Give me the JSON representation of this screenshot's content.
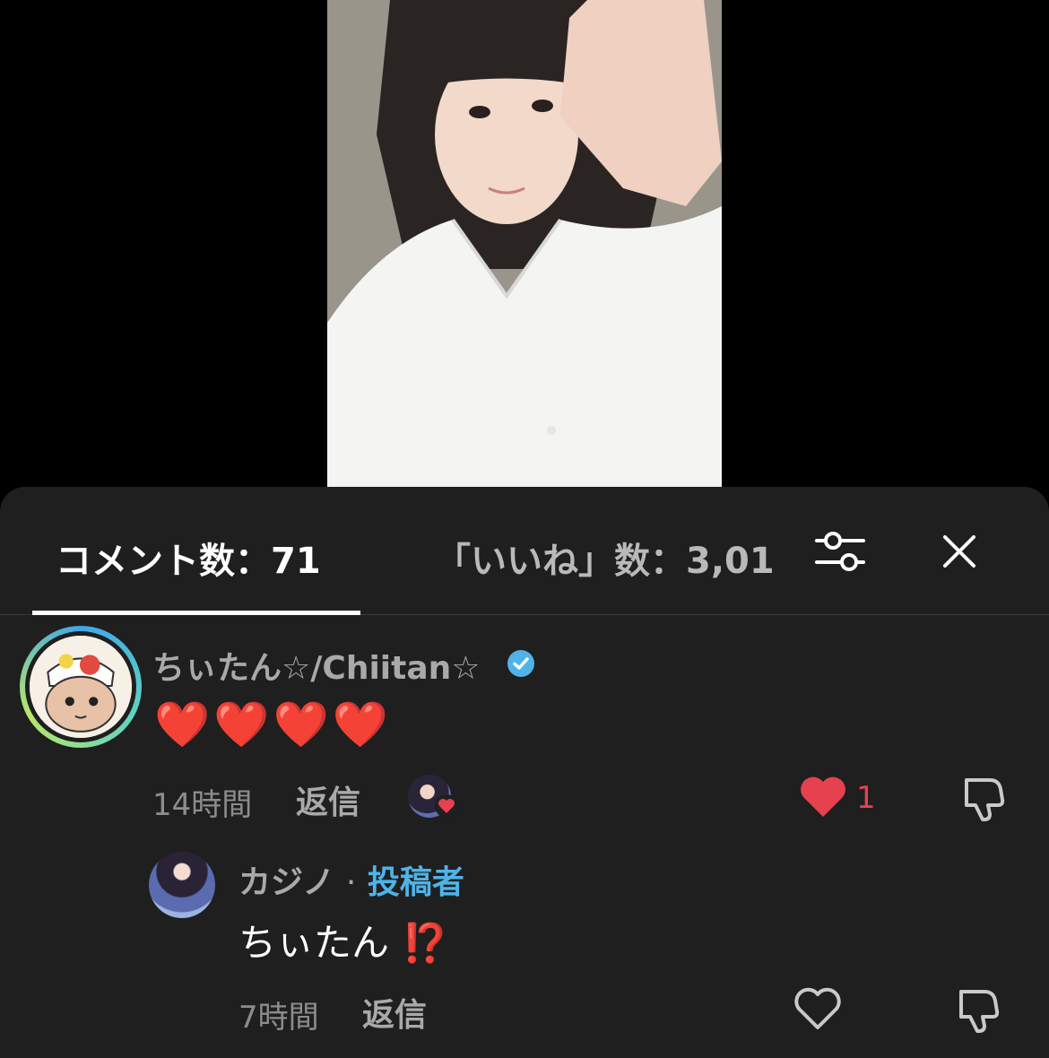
{
  "tabs": {
    "comments_label": "コメント数：71",
    "likes_label": "「いいね」数：3,01"
  },
  "icons": {
    "filter": "filter-sliders-icon",
    "close": "close-icon",
    "verified": "verified-badge-icon",
    "like": "heart-icon",
    "dislike": "thumbs-down-icon"
  },
  "colors": {
    "sheet_bg": "#1f1f1f",
    "like_red": "#e5414f",
    "author_blue": "#4fb3e8",
    "verified_blue": "#4fb3e8"
  },
  "comment": {
    "username": "ちぃたん☆/Chiitan☆",
    "text": "❤️❤️❤️❤️",
    "time": "14時間",
    "reply_label": "返信",
    "like_count": "1",
    "liked_by_creator": true
  },
  "reply": {
    "username": "カジノ",
    "separator": "·",
    "author_badge": "投稿者",
    "text": "ちぃたん",
    "emoji": "⁉️",
    "time": "7時間",
    "reply_label": "返信"
  }
}
